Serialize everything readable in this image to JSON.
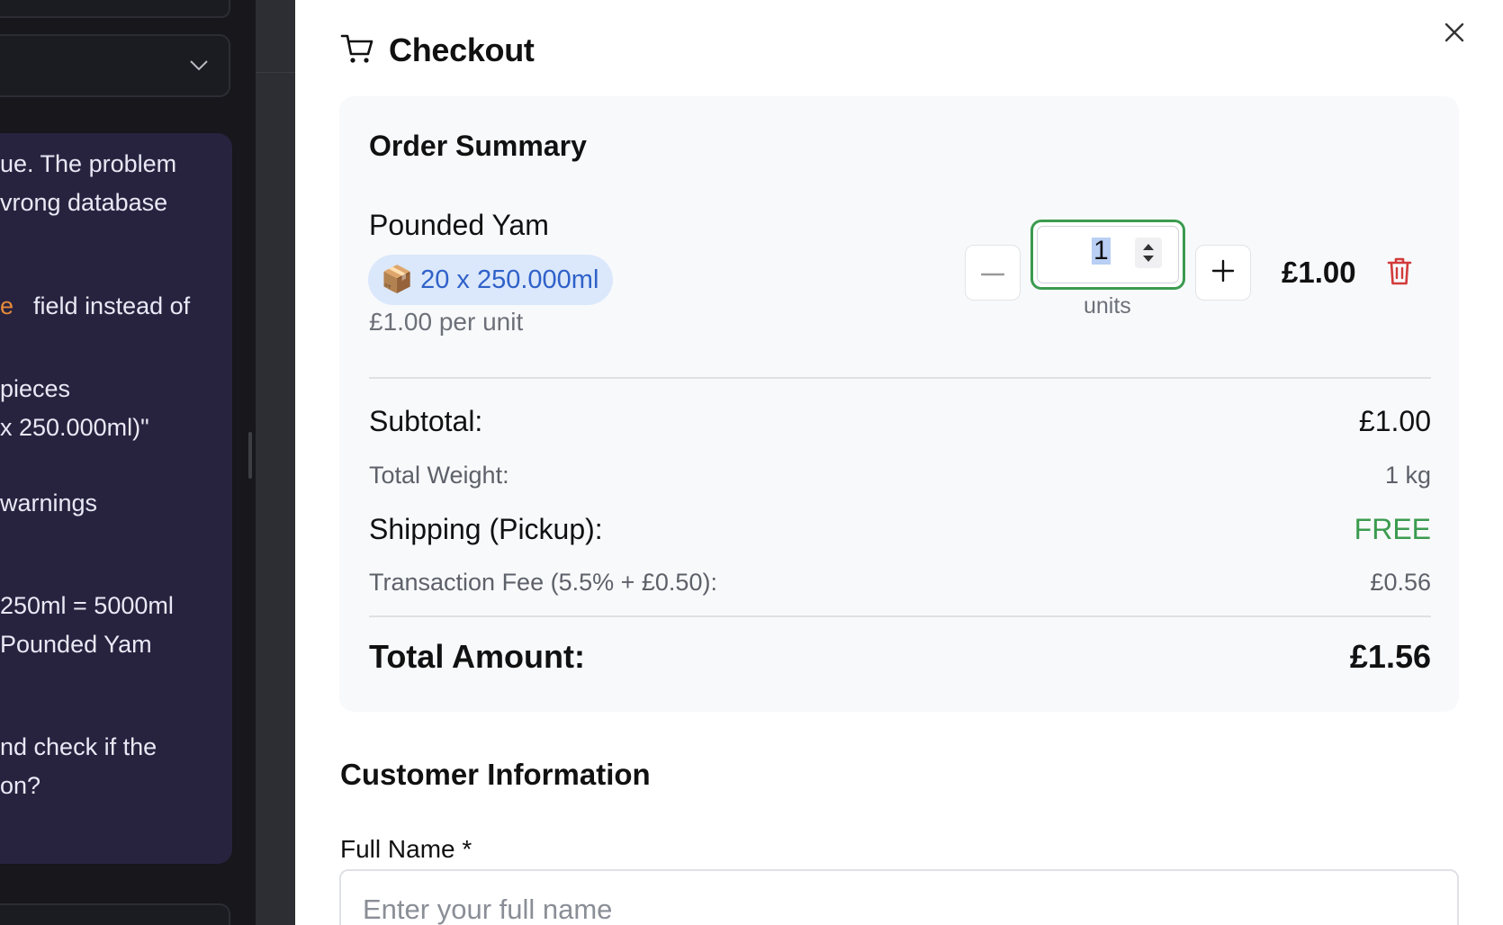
{
  "background_chat": {
    "lines": [
      "ue. The problem",
      "vrong database",
      "field instead of",
      "pieces",
      "x 250.000ml)\"",
      "warnings",
      "250ml = 5000ml",
      "Pounded Yam",
      "nd check if the",
      "on?"
    ],
    "highlight_fragment": "e"
  },
  "checkout": {
    "title": "Checkout",
    "icons": {
      "header": "shopping-cart-icon",
      "close": "close-icon"
    }
  },
  "order_summary": {
    "title": "Order Summary",
    "item": {
      "name": "Pounded Yam",
      "pack_emoji": "📦",
      "pack_label": "20 x 250.000ml",
      "unit_price": "£1.00 per unit",
      "quantity": "1",
      "quantity_unit": "units",
      "line_total": "£1.00"
    },
    "totals": {
      "subtotal_label": "Subtotal:",
      "subtotal_value": "£1.00",
      "weight_label": "Total Weight:",
      "weight_value": "1 kg",
      "shipping_label": "Shipping (Pickup):",
      "shipping_value": "FREE",
      "fee_label": "Transaction Fee (5.5% + £0.50):",
      "fee_value": "£0.56",
      "total_label": "Total Amount:",
      "total_value": "£1.56"
    }
  },
  "customer": {
    "title": "Customer Information",
    "full_name_label": "Full Name *",
    "full_name_placeholder": "Enter your full name",
    "full_name_value": ""
  },
  "colors": {
    "accent_green": "#3b9b4f",
    "badge_bg": "#dbe8fb",
    "badge_text": "#2f61c9",
    "danger": "#d23b3b"
  }
}
